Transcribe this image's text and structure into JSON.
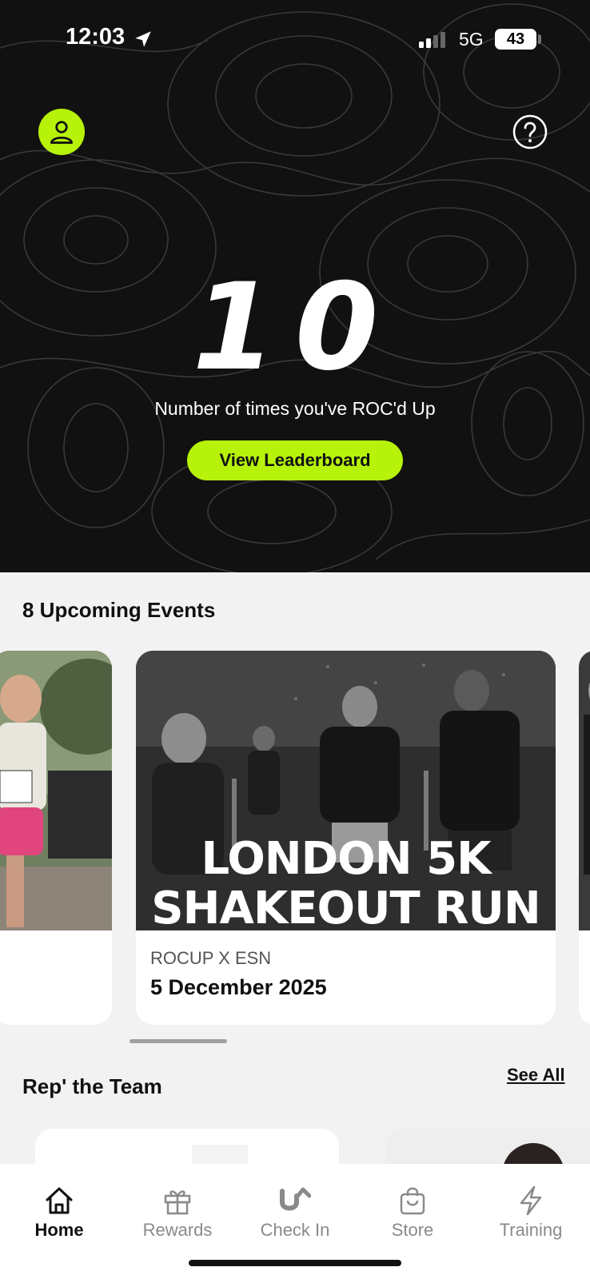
{
  "status_bar": {
    "time": "12:03",
    "network": "5G",
    "battery": "43"
  },
  "hero": {
    "count": "10",
    "count_label": "Number of times you've ROC'd Up",
    "leaderboard_button": "View Leaderboard",
    "accent_color": "#b6f20a",
    "icons": [
      "person-icon",
      "help-icon"
    ]
  },
  "events": {
    "title": "8 Upcoming Events",
    "items": [
      {
        "image_text": "LONDON 5K SHAKEOUT RUN",
        "image_line1": "LONDON 5K",
        "image_line2": "SHAKEOUT RUN",
        "organizer": "ROCUP X ESN",
        "date": "5 December 2025"
      }
    ]
  },
  "team": {
    "title": "Rep' the Team",
    "see_all": "See All"
  },
  "tabs": [
    {
      "label": "Home",
      "icon": "home-icon",
      "active": true
    },
    {
      "label": "Rewards",
      "icon": "gift-icon",
      "active": false
    },
    {
      "label": "Check In",
      "icon": "check-in-icon",
      "active": false
    },
    {
      "label": "Store",
      "icon": "shopping-bag-icon",
      "active": false
    },
    {
      "label": "Training",
      "icon": "lightning-icon",
      "active": false
    }
  ]
}
